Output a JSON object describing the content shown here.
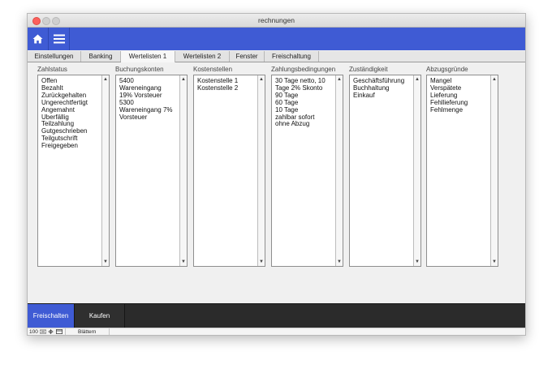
{
  "window": {
    "title": "rechnungen"
  },
  "tabs": [
    {
      "label": "Einstellungen",
      "active": false
    },
    {
      "label": "Banking",
      "active": false
    },
    {
      "label": "Wertelisten 1",
      "active": true
    },
    {
      "label": "Wertelisten 2",
      "active": false
    },
    {
      "label": "Fenster",
      "active": false
    },
    {
      "label": "Freischaltung",
      "active": false
    }
  ],
  "lists": [
    {
      "label": "Zahlstatus",
      "items": [
        "Offen",
        "Bezahlt",
        "Zurückgehalten",
        "Ungerechtfertigt",
        "Angemahnt",
        "Überfällig",
        "Teilzahlung",
        "Gutgeschrieben",
        "Teilgutschrift",
        "Freigegeben"
      ]
    },
    {
      "label": "Buchungskonten",
      "items": [
        "5400",
        "Wareneingang",
        "19% Vorsteuer",
        "5300",
        "Wareneingang 7%",
        "Vorsteuer"
      ]
    },
    {
      "label": "Kostenstellen",
      "items": [
        "Kostenstelle 1",
        "Kostenstelle 2"
      ]
    },
    {
      "label": "Zahlungsbedingungen",
      "items": [
        "30 Tage netto, 10",
        "Tage 2% Skonto",
        "90 Tage",
        "60 Tage",
        "10 Tage",
        "zahlbar sofort",
        "ohne Abzug"
      ]
    },
    {
      "label": "Zuständigkeit",
      "items": [
        "Geschäftsführung",
        "Buchhaltung",
        "Einkauf"
      ]
    },
    {
      "label": "Abzugsgründe",
      "items": [
        "Mangel",
        "Verspätete",
        "Lieferung",
        "Fehllieferung",
        "Fehlmenge"
      ]
    }
  ],
  "bottom": {
    "release_label": "Freischalten",
    "buy_label": "Kaufen"
  },
  "status": {
    "zoom": "100",
    "mode": "Blättern"
  },
  "colors": {
    "accent": "#3f5bd4",
    "bottom_bar": "#2b2b2b"
  }
}
